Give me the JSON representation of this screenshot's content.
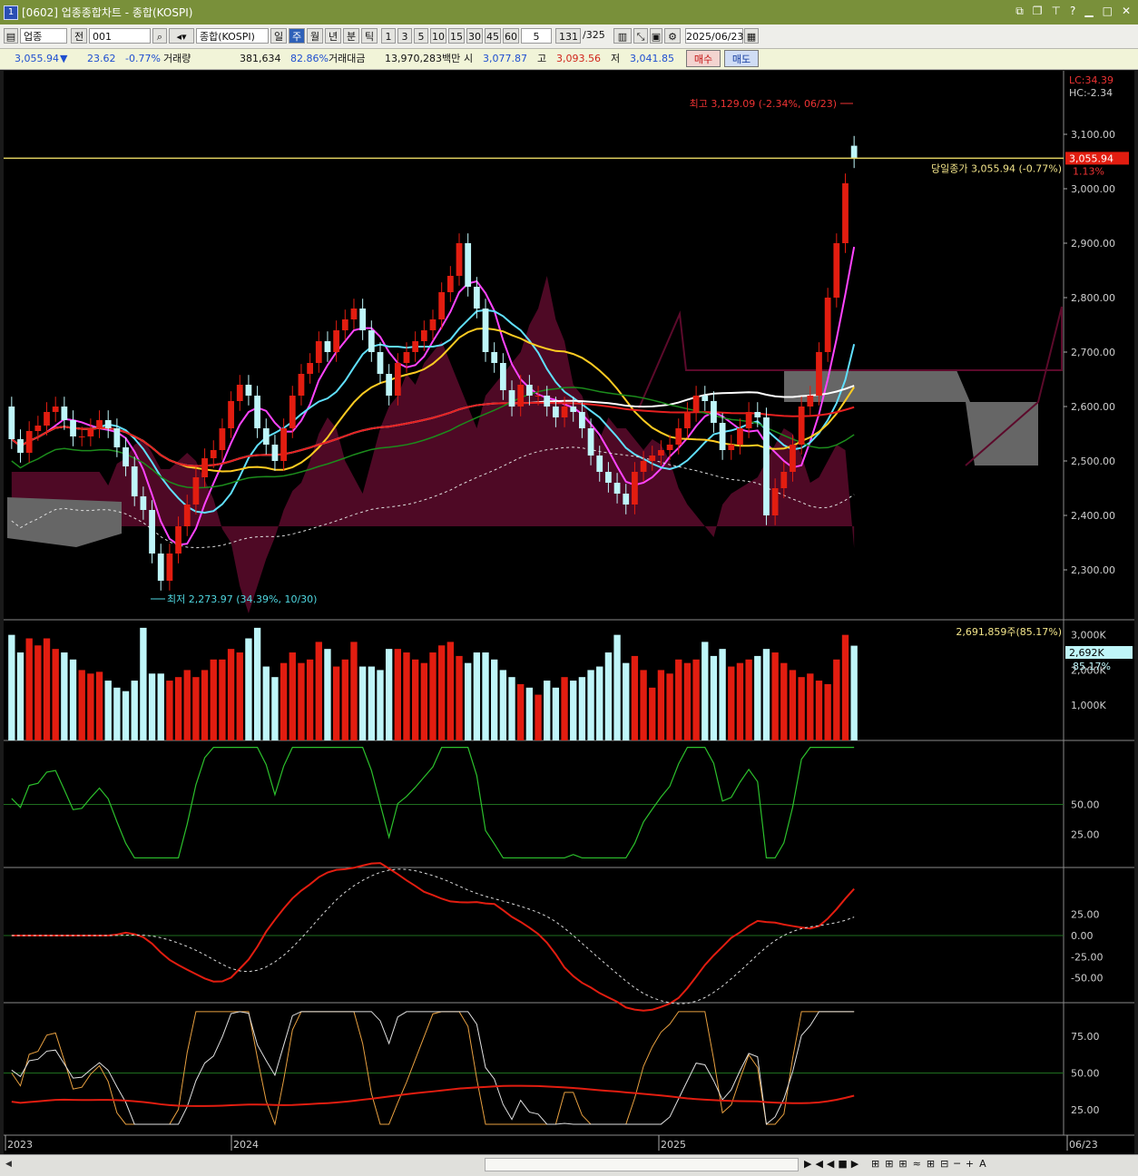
{
  "window": {
    "number": "1",
    "title": "[0602] 업종종합차트 - 종합(KOSPI)"
  },
  "toolbar": {
    "market": "업종",
    "prev": "전",
    "code": "001",
    "name": "종합(KOSPI)",
    "periods": [
      "일",
      "주",
      "월",
      "년",
      "분",
      "틱"
    ],
    "period_selected": "주",
    "intervals": [
      "1",
      "3",
      "5",
      "10",
      "15",
      "30",
      "45",
      "60"
    ],
    "interval_value": "5",
    "count": "131",
    "total": "/325",
    "date": "2025/06/23"
  },
  "quote": {
    "price": "3,055.94",
    "arrow": "▼",
    "change": "23.62",
    "change_pct": "-0.77%",
    "volume_label": "거래량",
    "volume": "381,634",
    "volume_pct": "82.86%",
    "amount_label": "거래대금",
    "amount": "13,970,283백만",
    "open_label": "시",
    "open": "3,077.87",
    "high_label": "고",
    "high": "3,093.56",
    "low_label": "저",
    "low": "3,041.85",
    "buy": "매수",
    "sell": "매도"
  },
  "colors": {
    "up": "#e21d10",
    "down": "#bff6f9",
    "cloud_pos": "#5c0a2b",
    "cloud_neg": "#666666",
    "baseline": "#e0d060",
    "signal": "#2a9a2a"
  },
  "chart_data": [
    {
      "type": "candlestick",
      "title": "종합(KOSPI)",
      "ylim": [
        2220,
        3200
      ],
      "y_ticks": [
        "3,100.00",
        "3,000.00",
        "2,900.00",
        "2,800.00",
        "2,700.00",
        "2,600.00",
        "2,500.00",
        "2,400.00",
        "2,300.00"
      ],
      "y_values": [
        3100,
        3000,
        2900,
        2800,
        2700,
        2600,
        2500,
        2400,
        2300
      ],
      "x_labels": [
        "2023",
        "2024",
        "2025",
        "06/23"
      ],
      "info": {
        "lc": "LC:34.39",
        "hc": "HC:-2.34",
        "last_tag": "3,055.94",
        "last_pct": "1.13%"
      },
      "annotations": {
        "high": "최고 3,129.09 (-2.34%, 06/23)",
        "low": "최저 2,273.97 (34.39%, 10/30)",
        "close": "당일종가 3,055.94 (-0.77%)"
      },
      "close": [
        2540,
        2515,
        2555,
        2565,
        2590,
        2600,
        2575,
        2545,
        2545,
        2560,
        2575,
        2560,
        2525,
        2490,
        2435,
        2410,
        2330,
        2280,
        2330,
        2380,
        2420,
        2470,
        2505,
        2520,
        2560,
        2610,
        2640,
        2620,
        2560,
        2530,
        2500,
        2560,
        2620,
        2660,
        2680,
        2720,
        2700,
        2740,
        2760,
        2780,
        2740,
        2700,
        2660,
        2620,
        2680,
        2700,
        2720,
        2740,
        2760,
        2810,
        2840,
        2900,
        2820,
        2780,
        2700,
        2680,
        2630,
        2600,
        2640,
        2620,
        2620,
        2600,
        2580,
        2600,
        2590,
        2560,
        2510,
        2480,
        2460,
        2440,
        2420,
        2480,
        2500,
        2510,
        2520,
        2530,
        2560,
        2590,
        2620,
        2610,
        2570,
        2520,
        2530,
        2560,
        2590,
        2580,
        2400,
        2450,
        2480,
        2530,
        2600,
        2620,
        2700,
        2800,
        2900,
        3010,
        3056
      ],
      "open": [
        2600,
        2540,
        2515,
        2555,
        2565,
        2590,
        2600,
        2575,
        2545,
        2545,
        2560,
        2575,
        2560,
        2525,
        2490,
        2435,
        2410,
        2330,
        2280,
        2330,
        2380,
        2420,
        2470,
        2505,
        2520,
        2560,
        2610,
        2640,
        2620,
        2560,
        2530,
        2500,
        2560,
        2620,
        2660,
        2680,
        2720,
        2700,
        2740,
        2760,
        2780,
        2740,
        2700,
        2660,
        2620,
        2680,
        2700,
        2720,
        2740,
        2760,
        2810,
        2840,
        2900,
        2820,
        2780,
        2700,
        2680,
        2630,
        2600,
        2640,
        2620,
        2620,
        2600,
        2580,
        2600,
        2590,
        2560,
        2510,
        2480,
        2460,
        2440,
        2420,
        2480,
        2500,
        2510,
        2520,
        2530,
        2560,
        2590,
        2620,
        2610,
        2570,
        2520,
        2530,
        2560,
        2590,
        2580,
        2400,
        2450,
        2480,
        2530,
        2600,
        2620,
        2700,
        2800,
        2900,
        3079
      ],
      "volume_panel": {
        "label": "2,691,859주(85.17%)",
        "tag": "2,692K",
        "tag_pct": "85.17%",
        "ticks": [
          "3,000K",
          "2,000K",
          "1,000K"
        ],
        "tick_values": [
          3000,
          2000,
          1000
        ],
        "ylim": [
          0,
          3300
        ]
      },
      "volume": [
        3000,
        2500,
        2900,
        2700,
        2900,
        2600,
        2500,
        2300,
        2000,
        1900,
        1950,
        1700,
        1500,
        1400,
        1700,
        3200,
        1900,
        1900,
        1700,
        1800,
        2000,
        1800,
        2000,
        2300,
        2300,
        2600,
        2500,
        2900,
        3200,
        2100,
        1800,
        2200,
        2500,
        2200,
        2300,
        2800,
        2600,
        2100,
        2300,
        2800,
        2100,
        2100,
        2000,
        2600,
        2600,
        2500,
        2300,
        2200,
        2500,
        2700,
        2800,
        2400,
        2200,
        2500,
        2500,
        2300,
        2000,
        1800,
        1600,
        1500,
        1300,
        1700,
        1500,
        1800,
        1700,
        1800,
        2000,
        2100,
        2500,
        3000,
        2200,
        2400,
        2000,
        1500,
        2000,
        1900,
        2300,
        2200,
        2300,
        2800,
        2400,
        2600,
        2100,
        2200,
        2300,
        2400,
        2600,
        2500,
        2200,
        2000,
        1800,
        1900,
        1700,
        1600,
        2300,
        3000,
        2692
      ]
    },
    {
      "type": "line",
      "panel": "oscillator",
      "ylim": [
        0,
        100
      ],
      "y_ticks": [
        "50.00",
        "25.00"
      ],
      "y_values": [
        50,
        25
      ]
    },
    {
      "type": "line",
      "panel": "macd",
      "ylim": [
        -75,
        75
      ],
      "y_ticks": [
        "25.00",
        "0.00",
        "-25.00",
        "-50.00"
      ],
      "y_values": [
        25,
        0,
        -25,
        -50
      ]
    },
    {
      "type": "line",
      "panel": "stochastic",
      "ylim": [
        10,
        95
      ],
      "y_ticks": [
        "75.00",
        "50.00",
        "25.00"
      ],
      "y_values": [
        75,
        50,
        25
      ]
    }
  ]
}
